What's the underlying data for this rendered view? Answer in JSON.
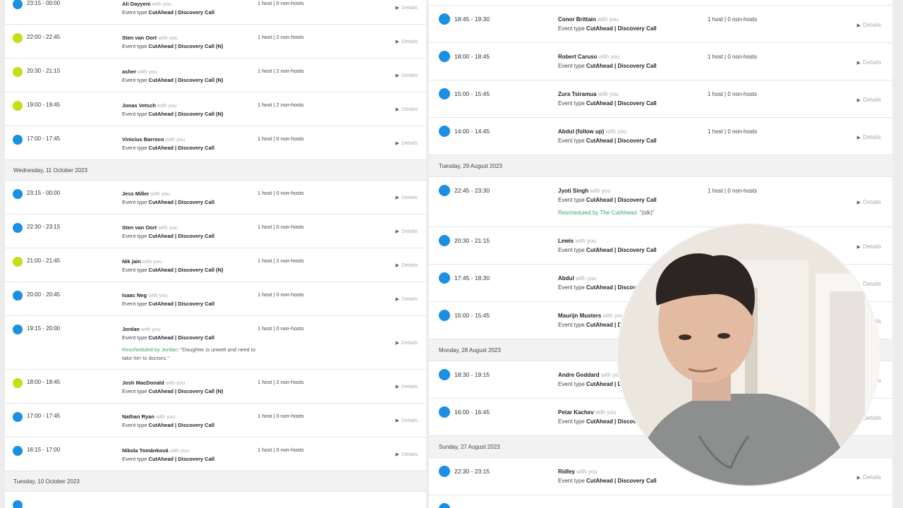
{
  "left": {
    "groups": [
      {
        "header": "",
        "rows": [
          {
            "time": "23:15 - 00:00",
            "color": "blue",
            "name": "Ali Dayyeni",
            "with_you": "with you",
            "etype_label": "Event type",
            "etype": "CutAhead | Discovery Call",
            "hosts": "1 host | 0 non-hosts",
            "details": "Details"
          },
          {
            "time": "22:00 - 22:45",
            "color": "lime",
            "name": "Sten van Oort",
            "with_you": "with you",
            "etype_label": "Event type",
            "etype": "CutAhead | Discovery Call (N)",
            "hosts": "1 host | 2 non-hosts",
            "details": "Details"
          },
          {
            "time": "20:30 - 21:15",
            "color": "lime",
            "name": "asher",
            "with_you": "with you",
            "etype_label": "Event type",
            "etype": "CutAhead | Discovery Call (N)",
            "hosts": "1 host | 2 non-hosts",
            "details": "Details"
          },
          {
            "time": "19:00 - 19:45",
            "color": "lime",
            "name": "Jonas Vetsch",
            "with_you": "with you",
            "etype_label": "Event type",
            "etype": "CutAhead | Discovery Call (N)",
            "hosts": "1 host | 2 non-hosts",
            "details": "Details"
          },
          {
            "time": "17:00 - 17:45",
            "color": "blue",
            "name": "Vinicius Barroco",
            "with_you": "with you",
            "etype_label": "Event type",
            "etype": "CutAhead | Discovery Call",
            "hosts": "1 host | 0 non-hosts",
            "details": "Details"
          }
        ]
      },
      {
        "header": "Wednesday, 11 October 2023",
        "rows": [
          {
            "time": "23:15 - 00:00",
            "color": "blue",
            "name": "Jess Miller",
            "with_you": "with you",
            "etype_label": "Event type",
            "etype": "CutAhead | Discovery Call",
            "hosts": "1 host | 0 non-hosts",
            "details": "Details"
          },
          {
            "time": "22:30 - 23:15",
            "color": "blue",
            "name": "Sten van Oort",
            "with_you": "with you",
            "etype_label": "Event type",
            "etype": "CutAhead | Discovery Call",
            "hosts": "1 host | 0 non-hosts",
            "details": "Details"
          },
          {
            "time": "21:00 - 21:45",
            "color": "lime",
            "name": "Nik jain",
            "with_you": "with you",
            "etype_label": "Event type",
            "etype": "CutAhead | Discovery Call (N)",
            "hosts": "1 host | 2 non-hosts",
            "details": "Details"
          },
          {
            "time": "20:00 - 20:45",
            "color": "blue",
            "name": "Isaac Neg",
            "with_you": "with you",
            "etype_label": "Event type",
            "etype": "CutAhead | Discovery Call",
            "hosts": "1 host | 0 non-hosts",
            "details": "Details"
          },
          {
            "time": "19:15 - 20:00",
            "color": "blue",
            "name": "Jordan",
            "with_you": "with you",
            "etype_label": "Event type",
            "etype": "CutAhead | Discovery Call",
            "hosts": "1 host | 0 non-hosts",
            "details": "Details",
            "resched_by": "Rescheduled by Jordan",
            "resched_note": ": \"Daughter is unwell and need to take her to doctors.\""
          },
          {
            "time": "18:00 - 18:45",
            "color": "lime",
            "name": "Josh MacDonald",
            "with_you": "with you",
            "etype_label": "Event type",
            "etype": "CutAhead | Discovery Call (N)",
            "hosts": "1 host | 2 non-hosts",
            "details": "Details"
          },
          {
            "time": "17:00 - 17:45",
            "color": "blue",
            "name": "Nathan Ryan",
            "with_you": "with you",
            "etype_label": "Event type",
            "etype": "CutAhead | Discovery Call",
            "hosts": "1 host | 0 non-hosts",
            "details": "Details"
          },
          {
            "time": "16:15 - 17:00",
            "color": "blue",
            "name": "Nikola Tománková",
            "with_you": "with you",
            "etype_label": "Event type",
            "etype": "CutAhead | Discovery Call",
            "hosts": "1 host | 0 non-hosts",
            "details": "Details"
          }
        ]
      },
      {
        "header": "Tuesday, 10 October 2023",
        "rows": [
          {
            "time": "",
            "color": "blue",
            "name": "",
            "with_you": "",
            "etype_label": "",
            "etype": "",
            "hosts": "",
            "details": ""
          }
        ]
      }
    ]
  },
  "right": {
    "groups": [
      {
        "header": "",
        "rows": [
          {
            "time": "",
            "color": "none",
            "name": "",
            "with_you": "",
            "etype_label": "",
            "etype": "",
            "hosts": "",
            "details": "",
            "stub": true
          },
          {
            "time": "18:45 - 19:30",
            "color": "blue",
            "name": "Conor Brittain",
            "with_you": "with you",
            "etype_label": "Event type",
            "etype": "CutAhead | Discovery Call",
            "hosts": "1 host | 0 non-hosts",
            "details": "Details"
          },
          {
            "time": "18:00 - 18:45",
            "color": "blue",
            "name": "Robert Caruso",
            "with_you": "with you",
            "etype_label": "Event type",
            "etype": "CutAhead | Discovery Call",
            "hosts": "1 host | 0 non-hosts",
            "details": "Details"
          },
          {
            "time": "15:00 - 15:45",
            "color": "blue",
            "name": "Zura Tsiramua",
            "with_you": "with you",
            "etype_label": "Event type",
            "etype": "CutAhead | Discovery Call",
            "hosts": "1 host | 0 non-hosts",
            "details": "Details"
          },
          {
            "time": "14:00 - 14:45",
            "color": "blue",
            "name": "Abdul (follow up)",
            "with_you": "with you",
            "etype_label": "Event type",
            "etype": "CutAhead | Discovery Call",
            "hosts": "1 host | 0 non-hosts",
            "details": "Details"
          }
        ]
      },
      {
        "header": "Tuesday, 29 August 2023",
        "rows": [
          {
            "time": "22:45 - 23:30",
            "color": "blue",
            "name": "Jyoti Singh",
            "with_you": "with you",
            "etype_label": "Event type",
            "etype": "CutAhead | Discovery Call",
            "hosts": "1 host | 0 non-hosts",
            "details": "Details",
            "resched_by": "Rescheduled by The CutAhead",
            "resched_note": ": \"(idk)\""
          },
          {
            "time": "20:30 - 21:15",
            "color": "blue",
            "name": "Lewis",
            "with_you": "with you",
            "etype_label": "Event type",
            "etype": "CutAhead | Discovery Call",
            "hosts": "",
            "details": "Details"
          },
          {
            "time": "17:45 - 18:30",
            "color": "blue",
            "name": "Abdul",
            "with_you": "with you",
            "etype_label": "Event type",
            "etype": "CutAhead | Discovery Call",
            "hosts": "",
            "details": "Details"
          },
          {
            "time": "15:00 - 15:45",
            "color": "blue",
            "name": "Maurijn Musters",
            "with_you": "with you",
            "etype_label": "Event type",
            "etype": "CutAhead | Discovery Call",
            "hosts": "",
            "details": "Details"
          }
        ]
      },
      {
        "header": "Monday, 28 August 2023",
        "rows": [
          {
            "time": "18:30 - 19:15",
            "color": "blue",
            "name": "Andre Goddard",
            "with_you": "with you",
            "etype_label": "Event type",
            "etype": "CutAhead | Discovery Call",
            "hosts": "",
            "details": "Details"
          },
          {
            "time": "16:00 - 16:45",
            "color": "blue",
            "name": "Petar Kachev",
            "with_you": "with you",
            "etype_label": "Event type",
            "etype": "CutAhead | Discovery Call",
            "hosts": "",
            "details": "Details"
          }
        ]
      },
      {
        "header": "Sunday, 27 August 2023",
        "rows": [
          {
            "time": "22:30 - 23:15",
            "color": "blue",
            "name": "Ridley",
            "with_you": "with you",
            "etype_label": "Event type",
            "etype": "CutAhead | Discovery Call",
            "hosts": "",
            "details": "Details"
          },
          {
            "time": "",
            "color": "blue",
            "name": "",
            "with_you": "",
            "etype_label": "",
            "etype": "",
            "hosts": "",
            "details": ""
          }
        ]
      }
    ]
  },
  "colors": {
    "blue": "#1a8fe3",
    "lime": "#c7dd16",
    "rescheduled": "#3aa66a"
  },
  "icons": {
    "details": "play-triangle-icon"
  }
}
